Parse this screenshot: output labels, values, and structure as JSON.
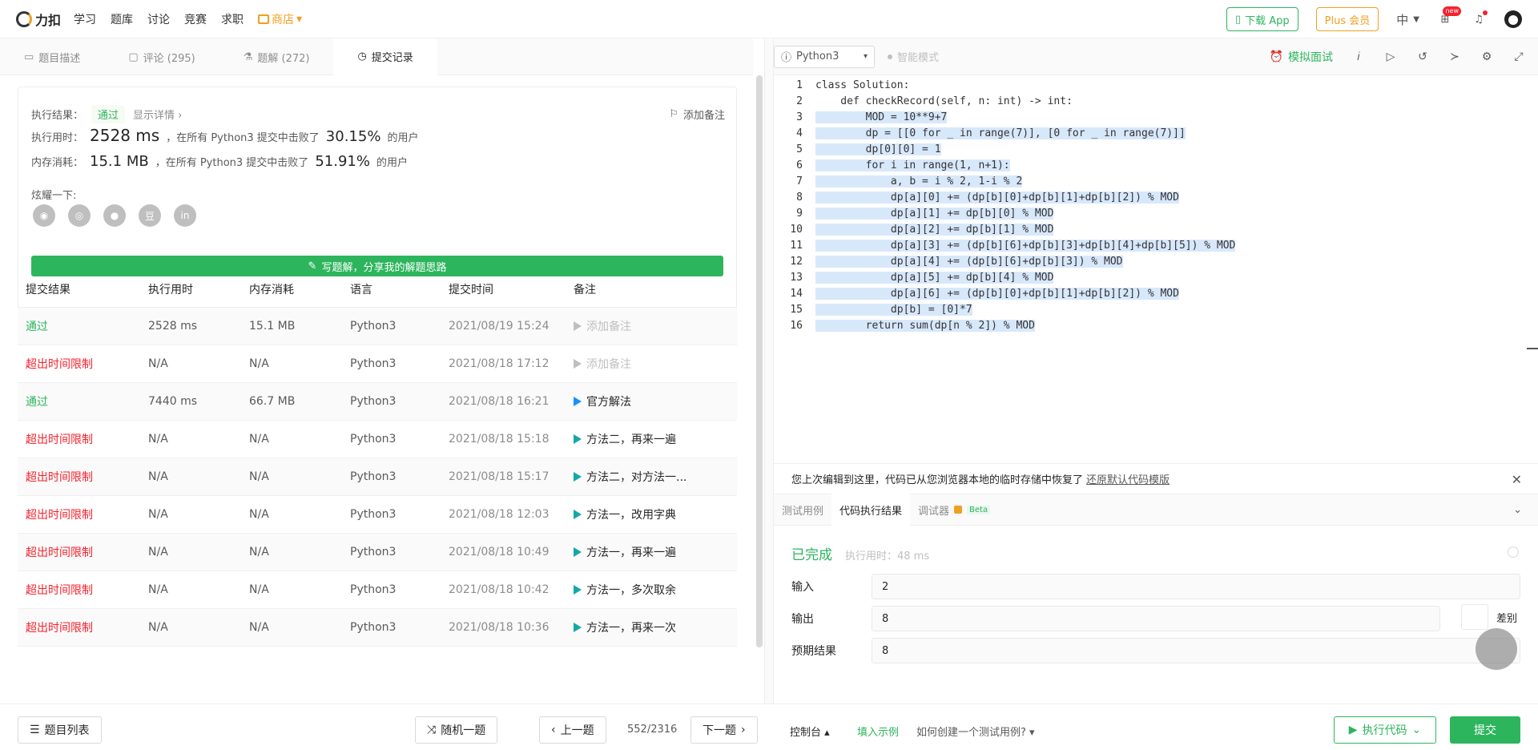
{
  "nav": {
    "brand": "力扣",
    "links": [
      "学习",
      "题库",
      "讨论",
      "竞赛",
      "求职"
    ],
    "store": "商店",
    "download_app": "下载 App",
    "plus": "Plus 会员",
    "lang": "中",
    "new_badge": "new"
  },
  "tabs": [
    {
      "label": "题目描述"
    },
    {
      "label": "评论 (295)"
    },
    {
      "label": "题解 (272)"
    },
    {
      "label": "提交记录"
    }
  ],
  "summary": {
    "result_label": "执行结果：",
    "result_value": "通过",
    "detail_link": "显示详情 ›",
    "add_note": "添加备注",
    "time_label": "执行用时：",
    "time_value": "2528 ms",
    "time_beat_text": "，在所有 Python3 提交中击败了",
    "time_beat_pct": "30.15%",
    "mem_label": "内存消耗：",
    "mem_value": "15.1 MB",
    "mem_beat_text": "，在所有 Python3 提交中击败了",
    "mem_beat_pct": "51.91%",
    "users_suffix": "的用户",
    "share_label": "炫耀一下:",
    "share_icons": [
      "wechat-icon",
      "weibo-icon",
      "qq-icon",
      "douban-icon",
      "linkedin-icon"
    ],
    "share_glyphs": [
      "◉",
      "◎",
      "●",
      "豆",
      "in"
    ],
    "write_button": "写题解，分享我的解题思路"
  },
  "table": {
    "headers": [
      "提交结果",
      "执行用时",
      "内存消耗",
      "语言",
      "提交时间",
      "备注"
    ],
    "rows": [
      {
        "result": "通过",
        "status": "ok",
        "time": "2528 ms",
        "mem": "15.1 MB",
        "lang": "Python3",
        "date": "2021/08/19 15:24",
        "note": "添加备注",
        "flag": "grey"
      },
      {
        "result": "超出时间限制",
        "status": "tle",
        "time": "N/A",
        "mem": "N/A",
        "lang": "Python3",
        "date": "2021/08/18 17:12",
        "note": "添加备注",
        "flag": "grey"
      },
      {
        "result": "通过",
        "status": "ok",
        "time": "7440 ms",
        "mem": "66.7 MB",
        "lang": "Python3",
        "date": "2021/08/18 16:21",
        "note": "官方解法",
        "flag": "blue"
      },
      {
        "result": "超出时间限制",
        "status": "tle",
        "time": "N/A",
        "mem": "N/A",
        "lang": "Python3",
        "date": "2021/08/18 15:18",
        "note": "方法二，再来一遍",
        "flag": "teal"
      },
      {
        "result": "超出时间限制",
        "status": "tle",
        "time": "N/A",
        "mem": "N/A",
        "lang": "Python3",
        "date": "2021/08/18 15:17",
        "note": "方法二，对方法一...",
        "flag": "teal"
      },
      {
        "result": "超出时间限制",
        "status": "tle",
        "time": "N/A",
        "mem": "N/A",
        "lang": "Python3",
        "date": "2021/08/18 12:03",
        "note": "方法一，改用字典",
        "flag": "teal"
      },
      {
        "result": "超出时间限制",
        "status": "tle",
        "time": "N/A",
        "mem": "N/A",
        "lang": "Python3",
        "date": "2021/08/18 10:49",
        "note": "方法一，再来一遍",
        "flag": "teal"
      },
      {
        "result": "超出时间限制",
        "status": "tle",
        "time": "N/A",
        "mem": "N/A",
        "lang": "Python3",
        "date": "2021/08/18 10:42",
        "note": "方法一，多次取余",
        "flag": "teal"
      },
      {
        "result": "超出时间限制",
        "status": "tle",
        "time": "N/A",
        "mem": "N/A",
        "lang": "Python3",
        "date": "2021/08/18 10:36",
        "note": "方法一，再来一次",
        "flag": "teal"
      }
    ]
  },
  "editor": {
    "language": "Python3",
    "smart_mode": "智能模式",
    "mock_interview": "模拟面试",
    "code_lines": [
      "class Solution:",
      "    def checkRecord(self, n: int) -> int:",
      "        MOD = 10**9+7",
      "        dp = [[0 for _ in range(7)], [0 for _ in range(7)]]",
      "        dp[0][0] = 1",
      "        for i in range(1, n+1):",
      "            a, b = i % 2, 1-i % 2",
      "            dp[a][0] += (dp[b][0]+dp[b][1]+dp[b][2]) % MOD",
      "            dp[a][1] += dp[b][0] % MOD",
      "            dp[a][2] += dp[b][1] % MOD",
      "            dp[a][3] += (dp[b][6]+dp[b][3]+dp[b][4]+dp[b][5]) % MOD",
      "            dp[a][4] += (dp[b][6]+dp[b][3]) % MOD",
      "            dp[a][5] += dp[b][4] % MOD",
      "            dp[a][6] += (dp[b][0]+dp[b][1]+dp[b][2]) % MOD",
      "            dp[b] = [0]*7",
      "        return sum(dp[n % 2]) % MOD"
    ]
  },
  "restore": {
    "message": "您上次编辑到这里，代码已从您浏览器本地的临时存储中恢复了",
    "link": "还原默认代码模版"
  },
  "bottom_tabs": [
    {
      "label": "测试用例"
    },
    {
      "label": "代码执行结果"
    },
    {
      "label": "调试器"
    }
  ],
  "beta": "Beta",
  "result": {
    "status": "已完成",
    "runtime": "执行用时：48 ms",
    "input_label": "输入",
    "input_value": "2",
    "output_label": "输出",
    "output_value": "8",
    "diff_label": "差别",
    "expected_label": "预期结果",
    "expected_value": "8"
  },
  "footer": {
    "problem_list": "题目列表",
    "random": "随机一题",
    "prev": "上一题",
    "counter": "552/2316",
    "next": "下一题",
    "console": "控制台",
    "fill_example": "填入示例",
    "how_to": "如何创建一个测试用例?",
    "run": "执行代码",
    "submit": "提交"
  },
  "colors": {
    "accent_green": "#2db55d",
    "error_red": "#f5222d",
    "store_orange": "#f0a020",
    "selection_blue": "#d7e8fb"
  }
}
